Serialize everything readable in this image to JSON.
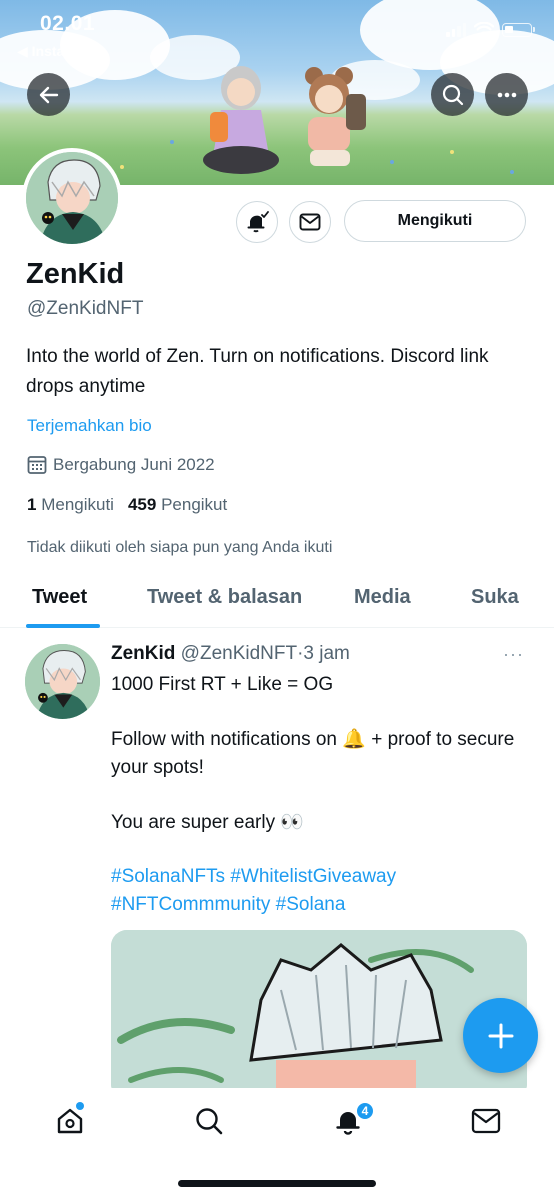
{
  "status_bar": {
    "time": "02.01",
    "back_app": "◀ Instagram"
  },
  "profile": {
    "name": "ZenKid",
    "handle": "@ZenKidNFT",
    "bio": "Into the world of Zen. Turn on notifications. Discord link drops anytime",
    "translate_label": "Terjemahkan bio",
    "joined": "Bergabung Juni 2022",
    "following_count": "1",
    "following_label": "Mengikuti",
    "followers_count": "459",
    "followers_label": "Pengikut",
    "not_followed_text": "Tidak diikuti oleh siapa pun yang Anda ikuti",
    "follow_button_label": "Mengikuti"
  },
  "tabs": [
    {
      "label": "Tweet",
      "active": true
    },
    {
      "label": "Tweet & balasan",
      "active": false
    },
    {
      "label": "Media",
      "active": false
    },
    {
      "label": "Suka",
      "active": false
    }
  ],
  "tweet": {
    "name": "ZenKid",
    "handle": "@ZenKidNFT",
    "separator": "·",
    "time": "3 jam",
    "more": "···",
    "line1": "1000 First RT + Like = OG",
    "line2": "Follow with notifications on 🔔 + proof to secure your spots!",
    "line3": "You are super early 👀",
    "hashtags": "#SolanaNFTs #WhitelistGiveaway #NFTCommmunity #Solana"
  },
  "bottom_nav": {
    "notifications_badge": "4"
  },
  "colors": {
    "accent": "#1d9bf0",
    "text": "#0f1419",
    "secondary_text": "#536471"
  },
  "icons": {
    "back": "arrow-left-icon",
    "search": "search-icon",
    "more": "more-horizontal-icon",
    "notify_bell": "bell-check-icon",
    "message": "envelope-icon",
    "calendar": "calendar-icon",
    "compose": "plus-icon",
    "home": "home-icon",
    "explore": "search-icon",
    "notifications": "bell-icon",
    "messages": "envelope-icon"
  }
}
